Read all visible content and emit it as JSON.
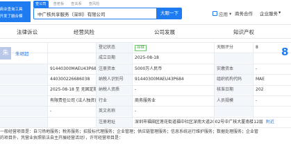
{
  "topbar": {
    "logo_line1": "的商业查询工具",
    "logo_line2": "家开发了融合模",
    "search_tabs": [
      "查公司",
      "查老板",
      "查关系",
      "查风险"
    ],
    "search_value": "中广核共享服务（深圳）有限公司",
    "search_button": "大眼一下",
    "app_label": "应用",
    "biz_label": "商务合作",
    "service_label": "企业服务"
  },
  "section_tabs": [
    "法律诉讼",
    "经营风险",
    "公司发展",
    "知识产权"
  ],
  "company": {
    "avatar_char": "朱",
    "person_name": "朱继超"
  },
  "rows": [
    {
      "l1": "",
      "v1": "",
      "l2": "登记状态",
      "v2": "存续",
      "l3": "天眼评分",
      "v3": "8"
    },
    {
      "l1": "",
      "v1": "",
      "l2": "成立日期",
      "v2": "2025-08-18",
      "l3": "",
      "v3": ""
    },
    {
      "l1": "",
      "v1": "91440300MAEU43P684",
      "l2": "注册资本",
      "v2": "5000万人民币",
      "l3": "实缴资本",
      "v3": "-"
    },
    {
      "l1": "",
      "v1": "440300226686038",
      "l2": "纳税人识别号",
      "v2": "91440300MAEU43P684",
      "l3": "组织机构代码",
      "v3": "MAE"
    },
    {
      "l1": "",
      "v1": "2025-08-18 至 无固定期限",
      "l2": "纳税人资质",
      "v2": "-",
      "l3": "核准日期",
      "v3": "202"
    },
    {
      "l1": "",
      "v1": "有限责任公司 (法人独资)",
      "l2": "行业",
      "v2": "商务服务业",
      "l3": "人员规模",
      "v3": "-"
    },
    {
      "l1": "",
      "v1": "-",
      "l2": "英文名称",
      "v2": "-",
      "l3": "",
      "v3": ""
    },
    {
      "l1": "",
      "v1": "",
      "l2": "注册地址",
      "v2": "深圳市福田区莲花街道福中社区深南大道2002号中广核大厦南楼12层",
      "l3": "附近",
      "v3": ""
    }
  ],
  "score_value": "8",
  "business_scope": [
    "一般经营项目是：自习场地服务；税务服务；招投标代理服务；企业管理；供应链管理服务；信息系统运行维护服务；数据处理服务；企业管",
    "的项目外，凭营业执照依法自主开展经营活动），许可经营项目是："
  ]
}
